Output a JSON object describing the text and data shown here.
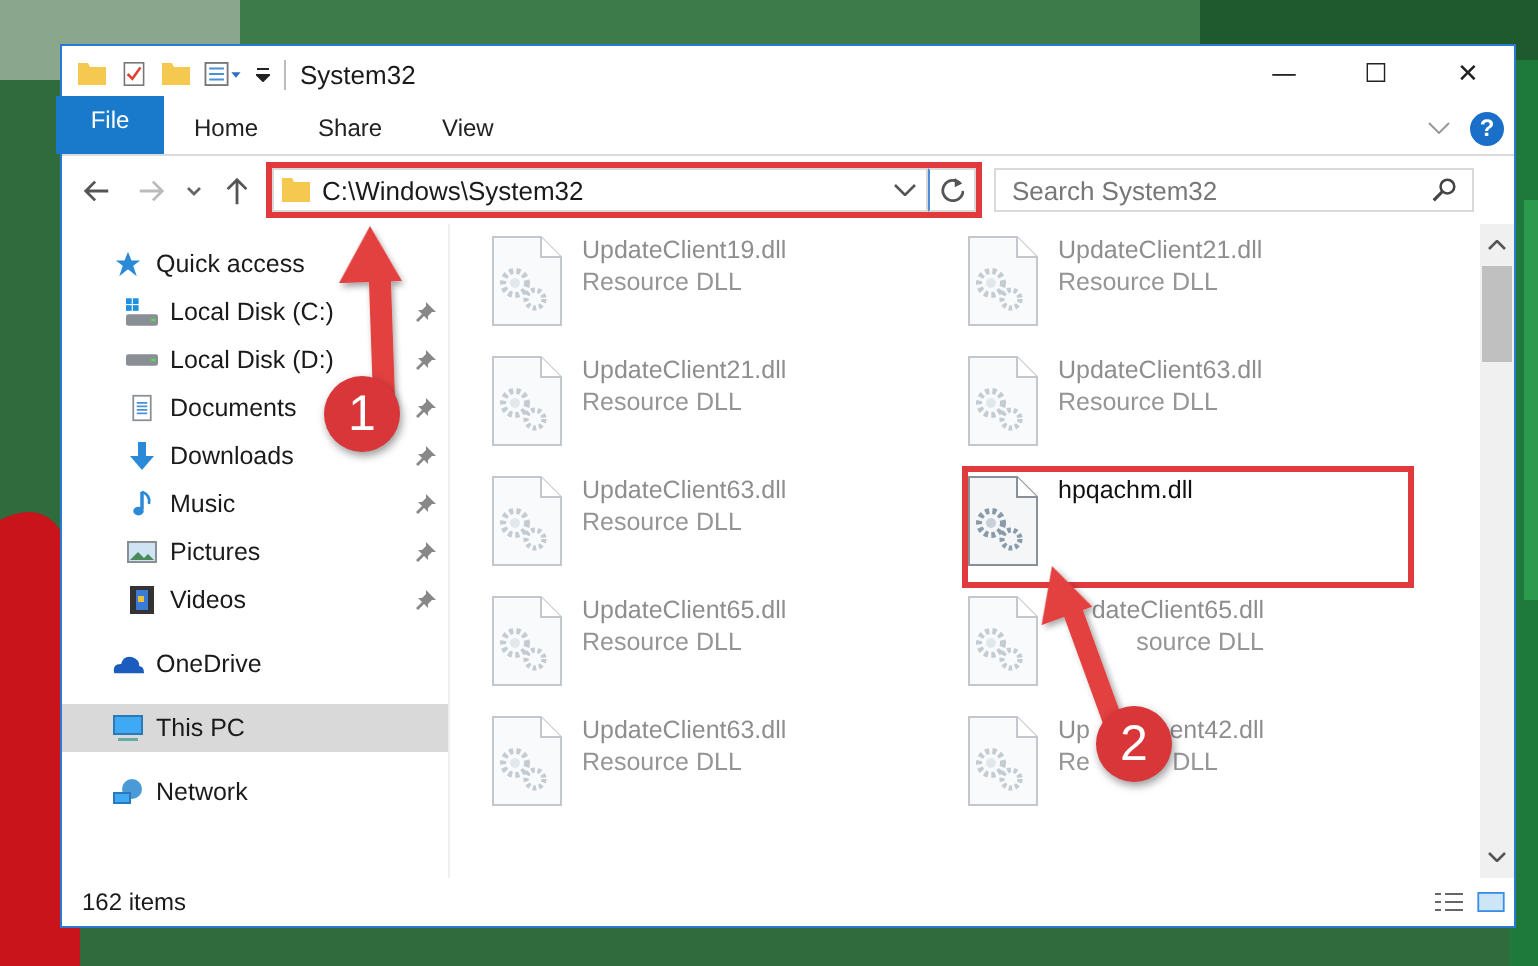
{
  "window": {
    "title": "System32",
    "minimize": "—",
    "maximize": "☐",
    "close": "✕"
  },
  "ribbon": {
    "tabs": [
      {
        "label": "File",
        "kind": "file",
        "selected": false
      },
      {
        "label": "Home",
        "kind": "tab",
        "selected": false
      },
      {
        "label": "Share",
        "kind": "tab",
        "selected": false
      },
      {
        "label": "View",
        "kind": "tab",
        "selected": false
      }
    ],
    "help": "?"
  },
  "address_bar": {
    "path": "C:\\Windows\\System32",
    "highlighted": true
  },
  "search": {
    "placeholder": "Search System32"
  },
  "sidebar": {
    "items": [
      {
        "label": "Quick access",
        "kind": "star",
        "selected": false,
        "children": [
          {
            "label": "Local Disk (C:)",
            "kind": "drive-win",
            "pinned": true,
            "selected": false
          },
          {
            "label": "Local Disk (D:)",
            "kind": "drive",
            "pinned": true,
            "selected": false
          },
          {
            "label": "Documents",
            "kind": "docs",
            "pinned": true,
            "selected": false
          },
          {
            "label": "Downloads",
            "kind": "download",
            "pinned": true,
            "selected": false
          },
          {
            "label": "Music",
            "kind": "music",
            "pinned": true,
            "selected": false
          },
          {
            "label": "Pictures",
            "kind": "pictures",
            "pinned": true,
            "selected": false
          },
          {
            "label": "Videos",
            "kind": "videos",
            "pinned": true,
            "selected": false
          }
        ]
      },
      {
        "label": "OneDrive",
        "kind": "cloud",
        "selected": false
      },
      {
        "label": "This PC",
        "kind": "pc",
        "selected": true
      },
      {
        "label": "Network",
        "kind": "network",
        "selected": false
      }
    ]
  },
  "files": [
    {
      "name": [
        "UpdateClient19.dll"
      ],
      "type": [
        "Resource DLL"
      ],
      "faded": true,
      "highlighted": false
    },
    {
      "name": [
        "UpdateClient21.dll"
      ],
      "type": [
        "Resource DLL"
      ],
      "faded": true,
      "highlighted": false
    },
    {
      "name": [
        "UpdateClient21.dll"
      ],
      "type": [
        "Resource DLL"
      ],
      "faded": true,
      "highlighted": false
    },
    {
      "name": [
        "UpdateClient63.dll"
      ],
      "type": [
        "Resource DLL"
      ],
      "faded": true,
      "highlighted": false
    },
    {
      "name": [
        "UpdateClient63.dll"
      ],
      "type": [
        "Resource DLL"
      ],
      "faded": true,
      "highlighted": false
    },
    {
      "name": [
        "hpqachm.dll"
      ],
      "faded": false,
      "highlighted": true
    },
    {
      "name": [
        "UpdateClient65.dll"
      ],
      "type": [
        "Resource DLL"
      ],
      "faded": true,
      "highlighted": false
    },
    {
      "name": [
        "dateClient65.dll"
      ],
      "type": [
        "source DLL"
      ],
      "faded": true,
      "highlighted": false,
      "covered": true
    },
    {
      "name": [
        "UpdateClient63.dll"
      ],
      "type": [
        "Resource DLL"
      ],
      "faded": true,
      "highlighted": false
    },
    {
      "name": [
        "Up",
        "ent42.dll"
      ],
      "type": [
        "Re",
        "DLL"
      ],
      "faded": true,
      "highlighted": false,
      "covered": true
    }
  ],
  "status_bar": {
    "count": "162 items"
  },
  "annotations": [
    {
      "number": "1"
    },
    {
      "number": "2"
    }
  ]
}
